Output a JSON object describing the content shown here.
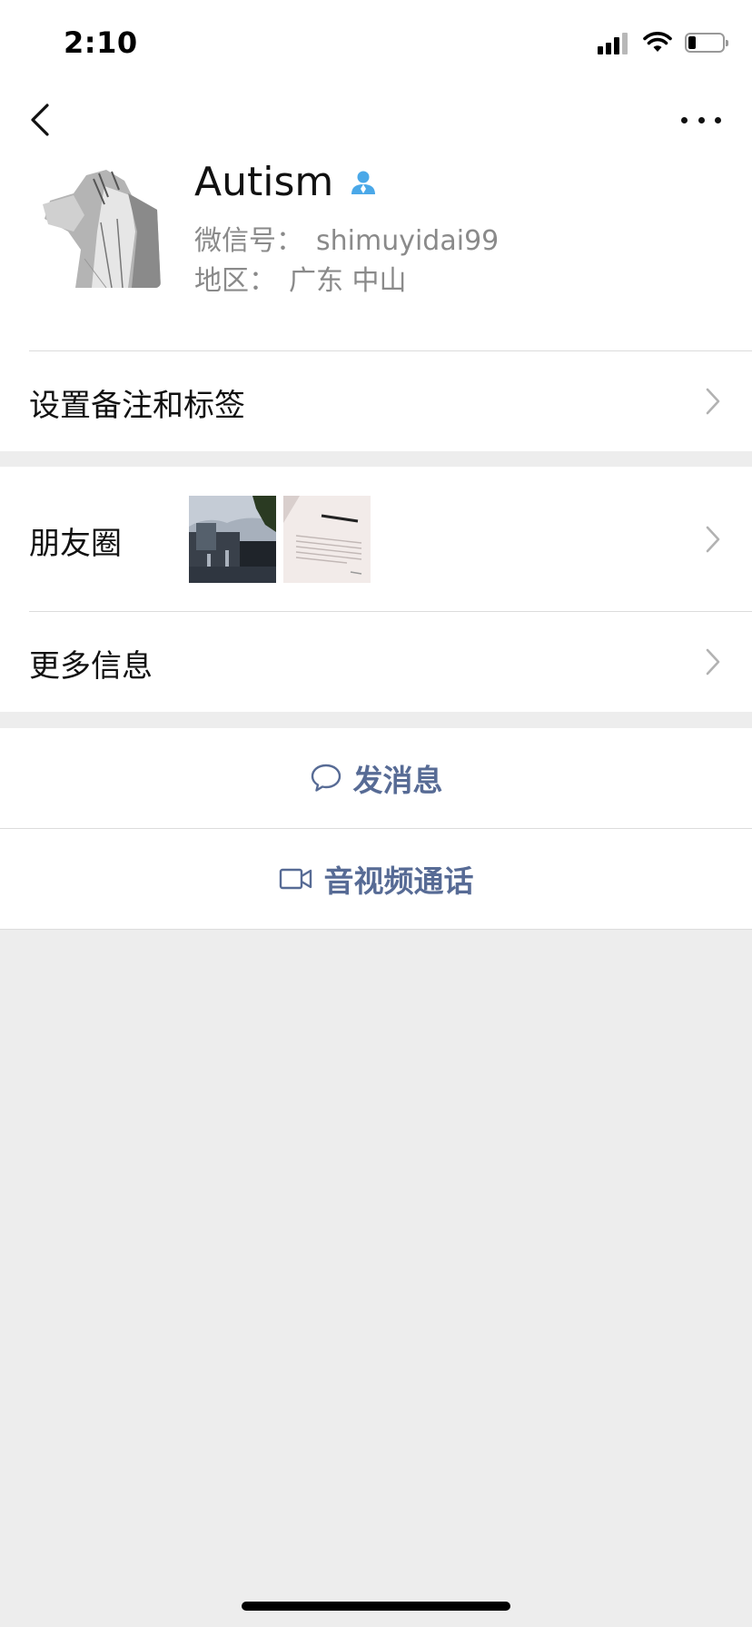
{
  "status_bar": {
    "time": "2:10",
    "signal_icon": "cellular-signal-icon",
    "wifi_icon": "wifi-icon",
    "battery_icon": "battery-low-icon"
  },
  "nav": {
    "back_icon": "chevron-left-icon",
    "more_icon": "more-dots-icon"
  },
  "profile": {
    "name": "Autism",
    "verify_icon": "user-badge-icon",
    "wxid_label": "微信号：",
    "wxid_value": "shimuyidai99",
    "region_label": "地区：",
    "region_value": "广东 中山"
  },
  "rows": {
    "remark_label": "设置备注和标签",
    "moments_label": "朋友圈",
    "more_info_label": "更多信息"
  },
  "actions": {
    "message_label": "发消息",
    "message_icon": "chat-bubble-icon",
    "call_label": "音视频通话",
    "call_icon": "video-camera-icon"
  },
  "colors": {
    "link": "#576b95",
    "background": "#ededed",
    "verify": "#4aa8e8"
  }
}
